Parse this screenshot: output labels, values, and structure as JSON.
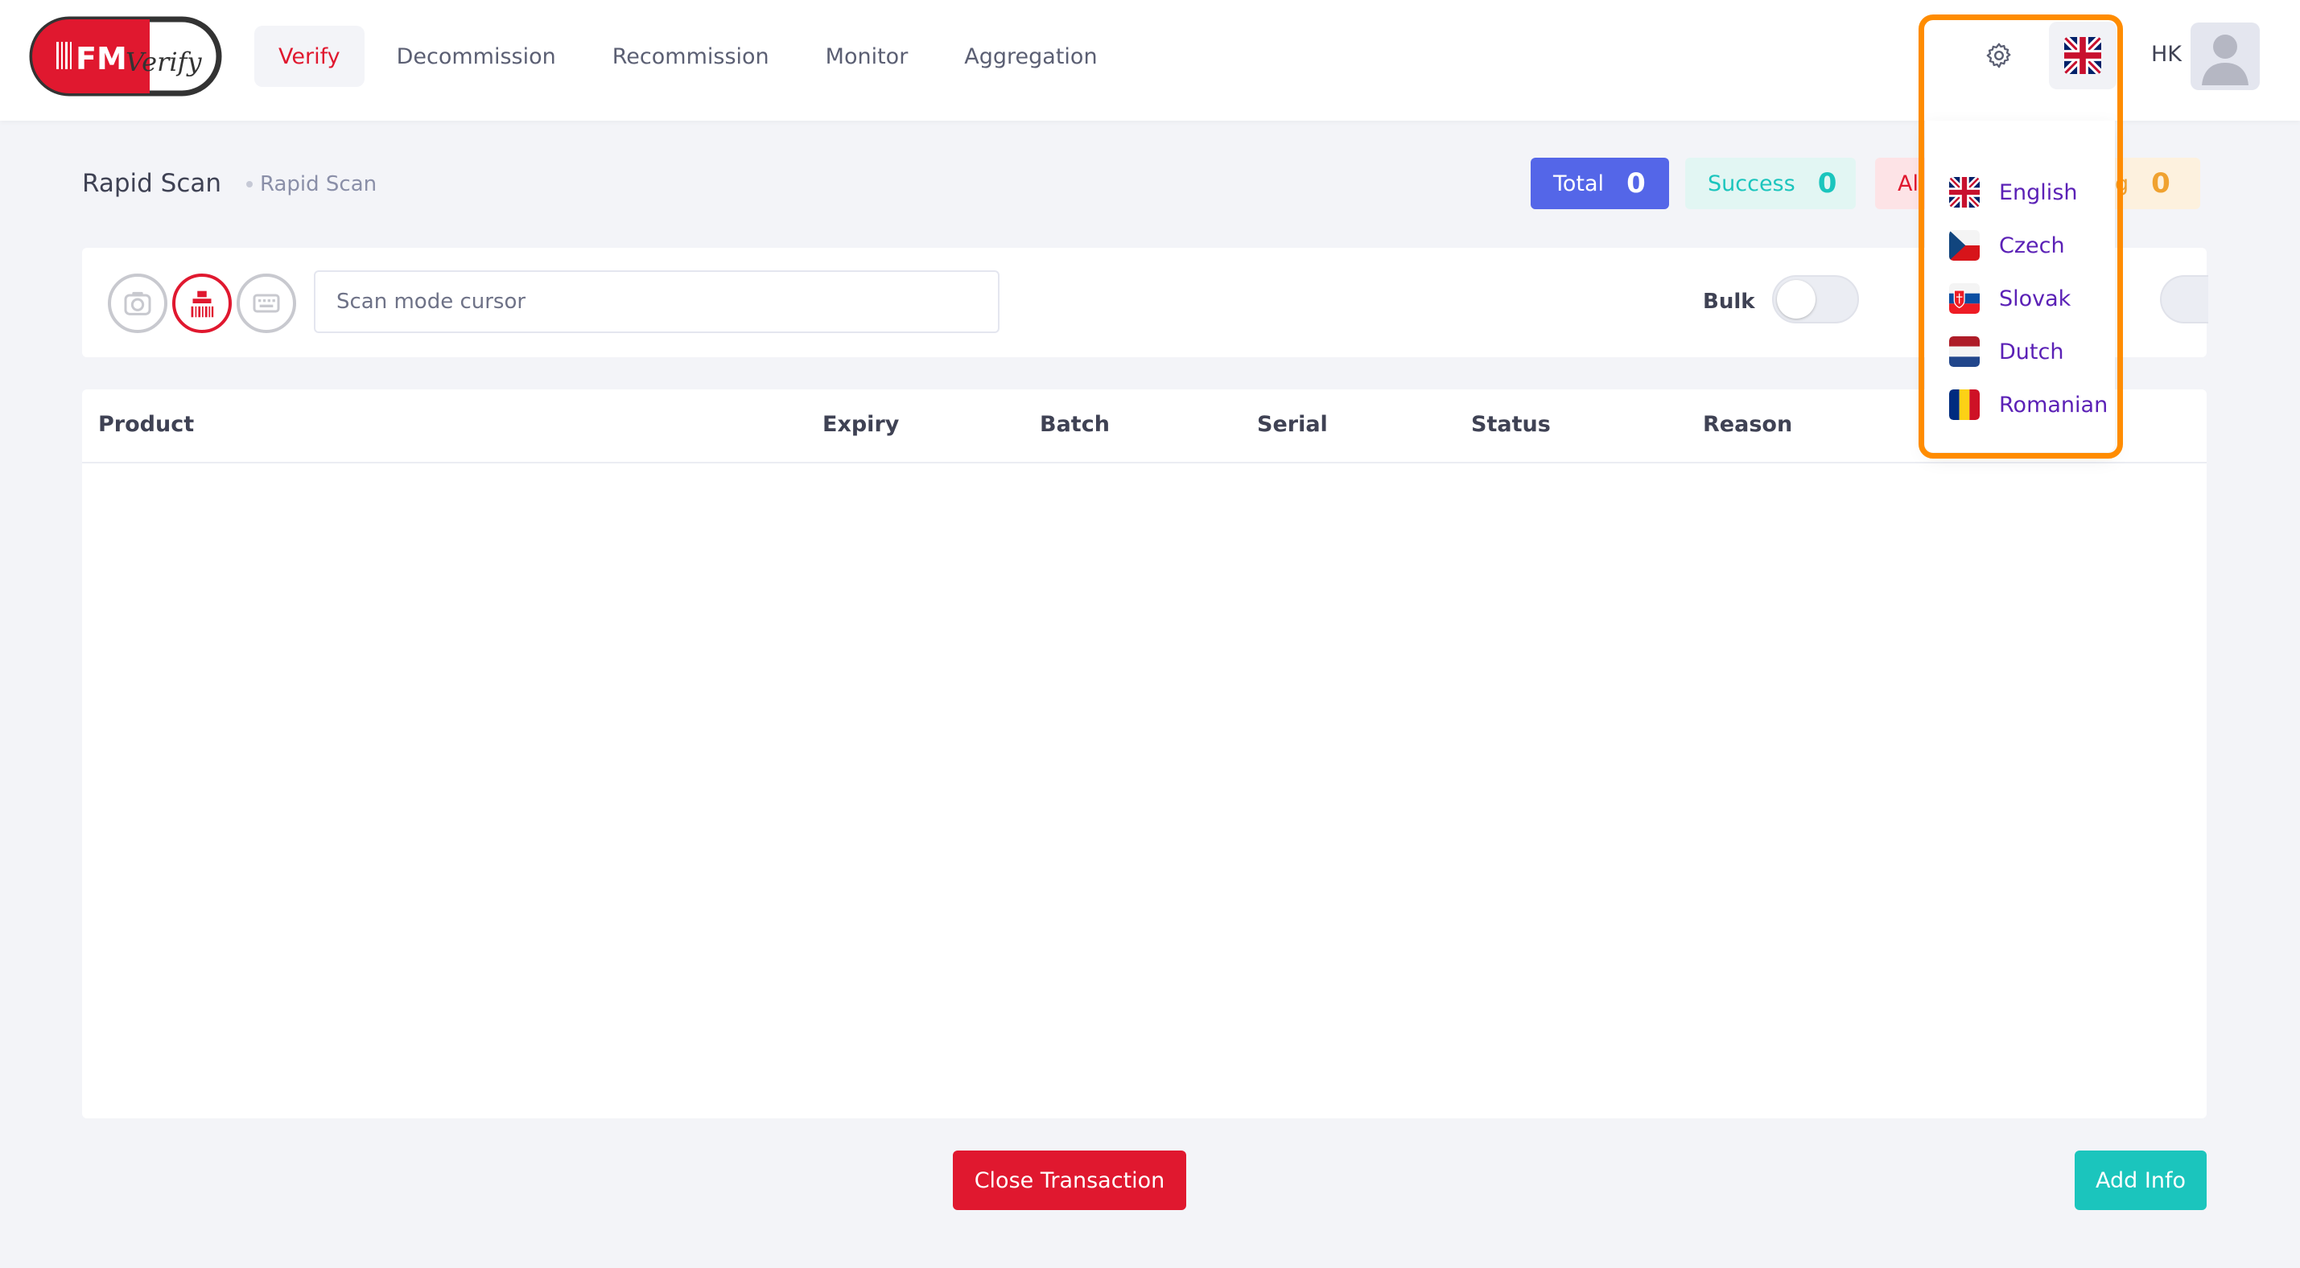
{
  "brand": {
    "logo_text": "FMVerify",
    "accent_color": "#e0182f"
  },
  "nav": {
    "items": [
      {
        "label": "Verify",
        "active": true
      },
      {
        "label": "Decommission"
      },
      {
        "label": "Recommission"
      },
      {
        "label": "Monitor"
      },
      {
        "label": "Aggregation"
      }
    ]
  },
  "header": {
    "settings_icon": "gear-icon",
    "language_flag": "uk-flag-icon",
    "user_initials": "HK"
  },
  "subheader": {
    "title": "Rapid Scan",
    "breadcrumb": "Rapid Scan",
    "stats": [
      {
        "label": "Total",
        "value": "0",
        "color": "#5466e8"
      },
      {
        "label": "Success",
        "value": "0",
        "color": "#1bc5bd"
      },
      {
        "label": "Al",
        "value": "",
        "color": "#e0182f"
      },
      {
        "label": "g",
        "value": "0",
        "color": "#f0a230"
      }
    ]
  },
  "scan": {
    "modes": [
      "camera-icon",
      "barcode-scanner-icon",
      "keyboard-icon"
    ],
    "active_mode": 1,
    "input_placeholder": "Scan mode cursor",
    "input_value": "",
    "bulk_label": "Bulk",
    "bulk_on": false
  },
  "table": {
    "columns": [
      "Product",
      "Expiry",
      "Batch",
      "Serial",
      "Status",
      "Reason"
    ],
    "rows": []
  },
  "actions": {
    "close_label": "Close Transaction",
    "add_info_label": "Add Info"
  },
  "languages": [
    {
      "label": "English",
      "flag": "uk-flag-icon"
    },
    {
      "label": "Czech",
      "flag": "czech-flag-icon"
    },
    {
      "label": "Slovak",
      "flag": "slovak-flag-icon"
    },
    {
      "label": "Dutch",
      "flag": "dutch-flag-icon"
    },
    {
      "label": "Romanian",
      "flag": "romanian-flag-icon"
    }
  ]
}
